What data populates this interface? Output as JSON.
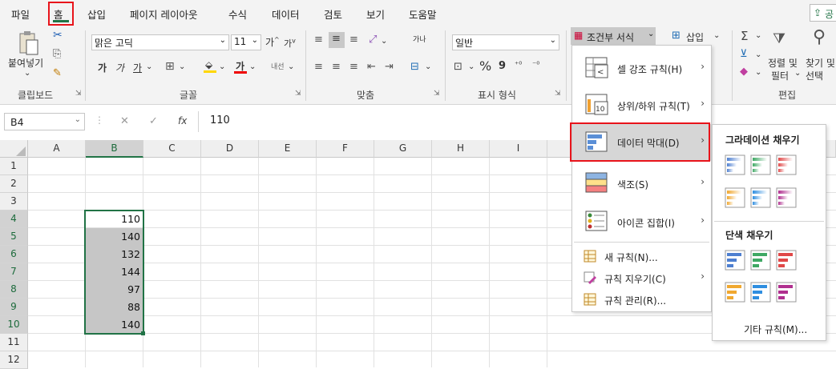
{
  "tabs": [
    "파일",
    "홈",
    "삽입",
    "페이지 레이아웃",
    "수식",
    "데이터",
    "검토",
    "보기",
    "도움말"
  ],
  "share_label": "공",
  "clipboard": {
    "paste_label": "붙여넣기",
    "group_label": "클립보드"
  },
  "font": {
    "name": "맑은 고딕",
    "size": "11",
    "bold": "가",
    "italic": "가",
    "underline": "가",
    "grow": "가",
    "shrink": "가",
    "phonetic": "내선",
    "font_color_glyph": "가",
    "group_label": "글꼴"
  },
  "alignment": {
    "group_label": "맞춤",
    "wrap_label": "가나"
  },
  "number": {
    "format": "일반",
    "percent": "%",
    "group_label": "표시 형식"
  },
  "styles": {
    "conditional_label": "조건부 서식"
  },
  "cells": {
    "insert_label": "삽입"
  },
  "editing": {
    "sort_label": "정렬 및",
    "filter_label": "필터",
    "find_label": "찾기 및",
    "select_label": "선택",
    "group_label": "편집"
  },
  "formula_bar": {
    "name_box": "B4",
    "cancel": "✕",
    "enter": "✓",
    "fx": "fx",
    "value": "110"
  },
  "columns": [
    "A",
    "B",
    "C",
    "D",
    "E",
    "F",
    "G",
    "H",
    "I"
  ],
  "rows": [
    "1",
    "2",
    "3",
    "4",
    "5",
    "6",
    "7",
    "8",
    "9",
    "10",
    "11",
    "12"
  ],
  "cells_b": [
    "110",
    "140",
    "132",
    "144",
    "97",
    "88",
    "140"
  ],
  "menu": {
    "items": [
      "셀 강조 규칙(H)",
      "상위/하위 규칙(T)",
      "데이터 막대(D)",
      "색조(S)",
      "아이콘 집합(I)"
    ],
    "small_items": [
      "새 규칙(N)...",
      "규칙 지우기(C)",
      "규칙 관리(R)..."
    ]
  },
  "submenu": {
    "gradient_label": "그라데이션 채우기",
    "solid_label": "단색 채우기",
    "more_label": "기타 규칙(M)..."
  },
  "colors": {
    "accent": "#217346",
    "highlight": "#e8141b",
    "selection_fill": "#c6c6c6",
    "menu_hover": "#d6d6d6"
  }
}
